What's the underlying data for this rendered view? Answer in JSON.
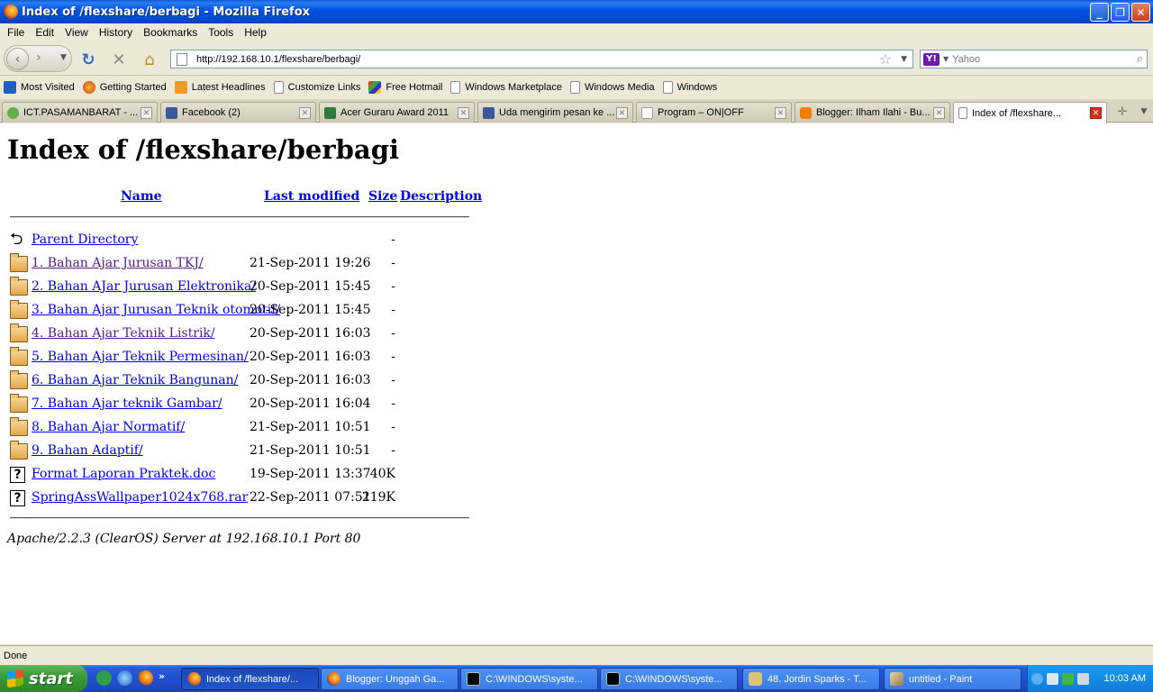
{
  "window": {
    "title": "Index of /flexshare/berbagi - Mozilla Firefox"
  },
  "menu": [
    {
      "label": "File"
    },
    {
      "label": "Edit"
    },
    {
      "label": "View"
    },
    {
      "label": "History"
    },
    {
      "label": "Bookmarks"
    },
    {
      "label": "Tools"
    },
    {
      "label": "Help"
    }
  ],
  "navigation": {
    "url": "http://192.168.10.1/flexshare/berbagi/",
    "search_placeholder": "Yahoo",
    "search_engine_label": "Y!"
  },
  "bookmarks": [
    {
      "label": "Most Visited",
      "icon": "most-visited-icon"
    },
    {
      "label": "Getting Started",
      "icon": "firefox-icon"
    },
    {
      "label": "Latest Headlines",
      "icon": "rss-icon"
    },
    {
      "label": "Customize Links",
      "icon": "page-icon"
    },
    {
      "label": "Free Hotmail",
      "icon": "windows-flag-icon"
    },
    {
      "label": "Windows Marketplace",
      "icon": "page-icon"
    },
    {
      "label": "Windows Media",
      "icon": "page-icon"
    },
    {
      "label": "Windows",
      "icon": "page-icon"
    }
  ],
  "tabs": [
    {
      "label": "ICT.PASAMANBARAT - ..."
    },
    {
      "label": "Facebook (2)"
    },
    {
      "label": "Acer Guraru Award 2011"
    },
    {
      "label": "Uda mengirim pesan ke ..."
    },
    {
      "label": "Program – ON|OFF"
    },
    {
      "label": "Blogger: Ilham Ilahi - Bu..."
    },
    {
      "label": "Index of /flexshare..."
    }
  ],
  "page": {
    "heading": "Index of /flexshare/berbagi",
    "columns": {
      "name": "Name",
      "last_modified": "Last modified",
      "size": "Size",
      "description": "Description"
    },
    "rows": [
      {
        "name": "Parent Directory",
        "date": "",
        "size": "-"
      },
      {
        "name": "1. Bahan Ajar Jurusan TKJ/",
        "date": "21-Sep-2011 19:26",
        "size": "-"
      },
      {
        "name": "2. Bahan AJar Jurusan Elektronika/",
        "date": "20-Sep-2011 15:45",
        "size": "-"
      },
      {
        "name": "3. Bahan Ajar Jurusan Teknik otomotif/",
        "date": "20-Sep-2011 15:45",
        "size": "-"
      },
      {
        "name": "4. Bahan Ajar Teknik Listrik/",
        "date": "20-Sep-2011 16:03",
        "size": "-"
      },
      {
        "name": "5. Bahan Ajar Teknik Permesinan/",
        "date": "20-Sep-2011 16:03",
        "size": "-"
      },
      {
        "name": "6. Bahan Ajar Teknik Bangunan/",
        "date": "20-Sep-2011 16:03",
        "size": "-"
      },
      {
        "name": "7. Bahan Ajar teknik Gambar/",
        "date": "20-Sep-2011 16:04",
        "size": "-"
      },
      {
        "name": "8. Bahan Ajar Normatif/",
        "date": "21-Sep-2011 10:51",
        "size": "-"
      },
      {
        "name": "9. Bahan Adaptif/",
        "date": "21-Sep-2011 10:51",
        "size": "-"
      },
      {
        "name": "Format Laporan Praktek.doc",
        "date": "19-Sep-2011 13:37",
        "size": "40K"
      },
      {
        "name": "SpringAssWallpaper1024x768.rar",
        "date": "22-Sep-2011 07:51",
        "size": "219K"
      }
    ],
    "server_signature": "Apache/2.2.3 (ClearOS) Server at 192.168.10.1 Port 80"
  },
  "status": {
    "text": "Done"
  },
  "taskbar": {
    "start_label": "start",
    "more_label": "»",
    "tasks": [
      {
        "label": "Index of /flexshare/..."
      },
      {
        "label": "Blogger: Unggah Ga..."
      },
      {
        "label": "C:\\WINDOWS\\syste..."
      },
      {
        "label": "C:\\WINDOWS\\syste..."
      },
      {
        "label": "48. Jordin Sparks - T..."
      },
      {
        "label": "untitled - Paint"
      }
    ],
    "clock": "10:03 AM"
  },
  "colors": {
    "link": "#0000EE",
    "visited_link": "#551A8B",
    "titlebar": "#0055E5",
    "taskbar": "#245EDB",
    "start_button": "#3A9B3A"
  }
}
